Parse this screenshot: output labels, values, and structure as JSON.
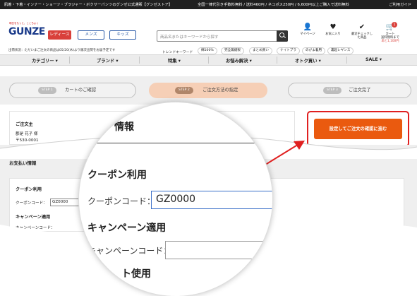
{
  "topbar": {
    "left": "肌着・下着・インナー・ショーツ・ブラジャー・ボクサーパンツのグンゼ公式通販【グンゼストア】",
    "right": "全国一律代引き手数料無料 / 送料460円 / ネコポス250円 / 6,600円以上ご購入で送料無料",
    "guide": "ご利用ガイド"
  },
  "header": {
    "logo_tag": "明日をもっと、ここちよく",
    "logo": "GUNZE",
    "categories": [
      "レディース",
      "メンズ",
      "キッズ"
    ],
    "notice": "出荷状況：ただいまご注文の商品は05/20(木)より順次出荷をお届予定です",
    "search_placeholder": "商品名またはキーワードから探す",
    "trend_label": "トレンドキーワード",
    "trend_tags": [
      "綿100%",
      "完全無縫製",
      "まとめ買い",
      "ナイトブラ",
      "のびよ着用",
      "裏起レギンス"
    ],
    "icons": [
      {
        "name": "mypage-icon",
        "glyph": "👤",
        "label": "マイページ"
      },
      {
        "name": "favorite-icon",
        "glyph": "♥",
        "label": "お気に入り"
      },
      {
        "name": "recent-check-icon",
        "glyph": "✔",
        "label": "最近チェックした商品"
      },
      {
        "name": "cart-icon",
        "glyph": "🛒",
        "label": "カート"
      }
    ],
    "cart_count": "1",
    "cart_note_1": "送料無料まで",
    "cart_note_2": "あと1,100円"
  },
  "nav": [
    "カテゴリー ▾",
    "ブランド ▾",
    "特集 ▾",
    "お悩み解決 ▾",
    "オトク買い ▾",
    "SALE ▾"
  ],
  "steps": [
    {
      "num": "STEP 1",
      "label": "カートのご確認",
      "active": false
    },
    {
      "num": "STEP 2",
      "label": "ご注文方法の指定",
      "active": true
    },
    {
      "num": "STEP 3",
      "label": "ご注文完了",
      "active": false
    }
  ],
  "orderer": {
    "title": "ご注文主",
    "name": "郡是 花子 様",
    "zip": "〒530-0001"
  },
  "cta_label": "設定してご注文の確認に進む",
  "payment": {
    "title": "お支払い情報",
    "coupon_title": "クーポン利用",
    "coupon_label": "クーポンコード：",
    "coupon_value": "GZ0000",
    "campaign_title": "キャンペーン適用",
    "campaign_label": "キャンペーンコード："
  },
  "zoom": {
    "heading_partial": "情報",
    "coupon_title": "クーポン利用",
    "coupon_label": "クーポンコード：",
    "coupon_value": "GZ0000",
    "campaign_title": "キャンペーン適用",
    "campaign_label": "キャンペーンコード：",
    "point_partial": "ト使用"
  },
  "colors": {
    "accent_orange": "#ea5a0f",
    "highlight_red": "#e02020",
    "step_active": "#f6cfb6",
    "brand_blue": "#1a3a8a"
  }
}
